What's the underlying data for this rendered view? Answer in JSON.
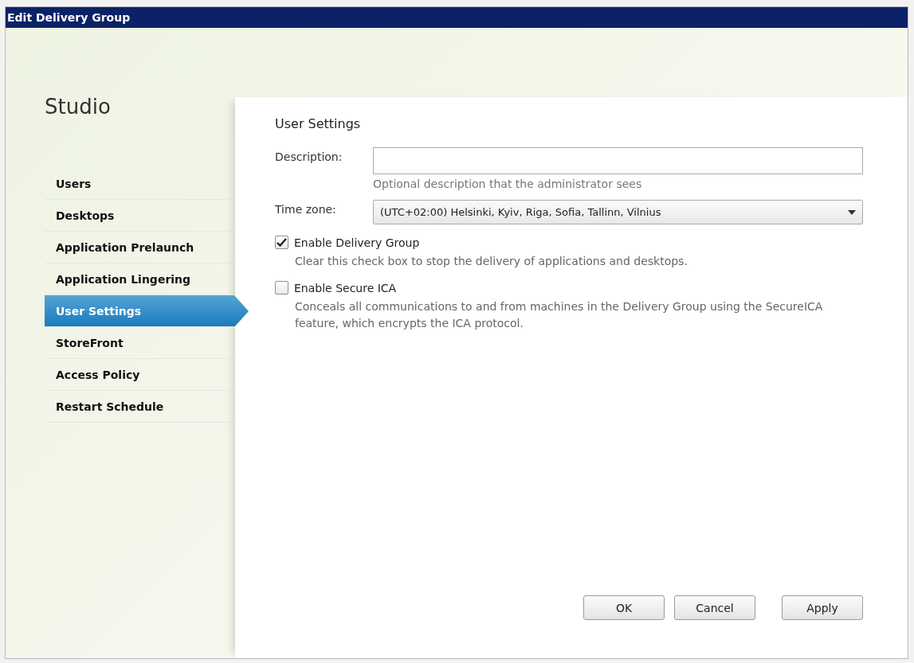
{
  "window": {
    "title": "Edit Delivery Group"
  },
  "sidebar": {
    "title": "Studio",
    "items": [
      {
        "label": "Users",
        "selected": false
      },
      {
        "label": "Desktops",
        "selected": false
      },
      {
        "label": "Application Prelaunch",
        "selected": false
      },
      {
        "label": "Application Lingering",
        "selected": false
      },
      {
        "label": "User Settings",
        "selected": true
      },
      {
        "label": "StoreFront",
        "selected": false
      },
      {
        "label": "Access Policy",
        "selected": false
      },
      {
        "label": "Restart Schedule",
        "selected": false
      }
    ]
  },
  "page": {
    "title": "User Settings",
    "description": {
      "label": "Description:",
      "hint": "Optional description that the administrator sees"
    },
    "time_zone": {
      "label": "Time zone:",
      "value": "(UTC+02:00) Helsinki, Kyiv, Riga, Sofia, Tallinn, Vilnius"
    },
    "checkboxes": [
      {
        "label": "Enable Delivery Group",
        "checked": true,
        "help": "Clear this check box to stop the delivery of applications and desktops."
      },
      {
        "label": "Enable Secure ICA",
        "checked": false,
        "help": "Conceals all communications to and from machines in the Delivery Group using the SecureICA feature, which encrypts the ICA protocol."
      }
    ]
  },
  "buttons": [
    "OK",
    "Cancel",
    "Apply"
  ]
}
